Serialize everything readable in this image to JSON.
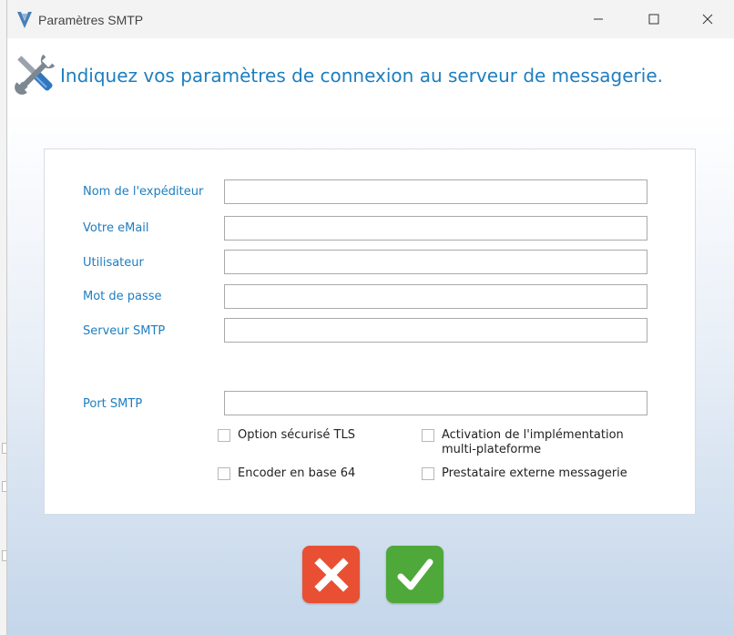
{
  "window": {
    "title": "Paramètres SMTP",
    "header": "Indiquez vos paramètres de connexion au serveur de messagerie."
  },
  "form": {
    "fields": [
      {
        "label": "Nom de l'expéditeur",
        "value": ""
      },
      {
        "label": "Votre eMail",
        "value": ""
      },
      {
        "label": "Utilisateur",
        "value": ""
      },
      {
        "label": "Mot de passe",
        "value": ""
      },
      {
        "label": "Serveur SMTP",
        "value": ""
      },
      {
        "label": "Port SMTP",
        "value": ""
      }
    ],
    "options": [
      {
        "label": "Option sécurisé TLS",
        "checked": false
      },
      {
        "label": "Activation de l'implémentation",
        "label2": "multi-plateforme",
        "checked": false
      },
      {
        "label": "Encoder en base 64",
        "checked": false
      },
      {
        "label": "Prestataire externe messagerie",
        "checked": false
      }
    ]
  },
  "colors": {
    "accent": "#1e7ec0",
    "cancel": "#e94f33",
    "confirm": "#4fa83a"
  },
  "icons": {
    "app": "app-logo-icon",
    "header": "tools-icon",
    "cancel": "close-icon",
    "confirm": "checkmark-icon"
  }
}
